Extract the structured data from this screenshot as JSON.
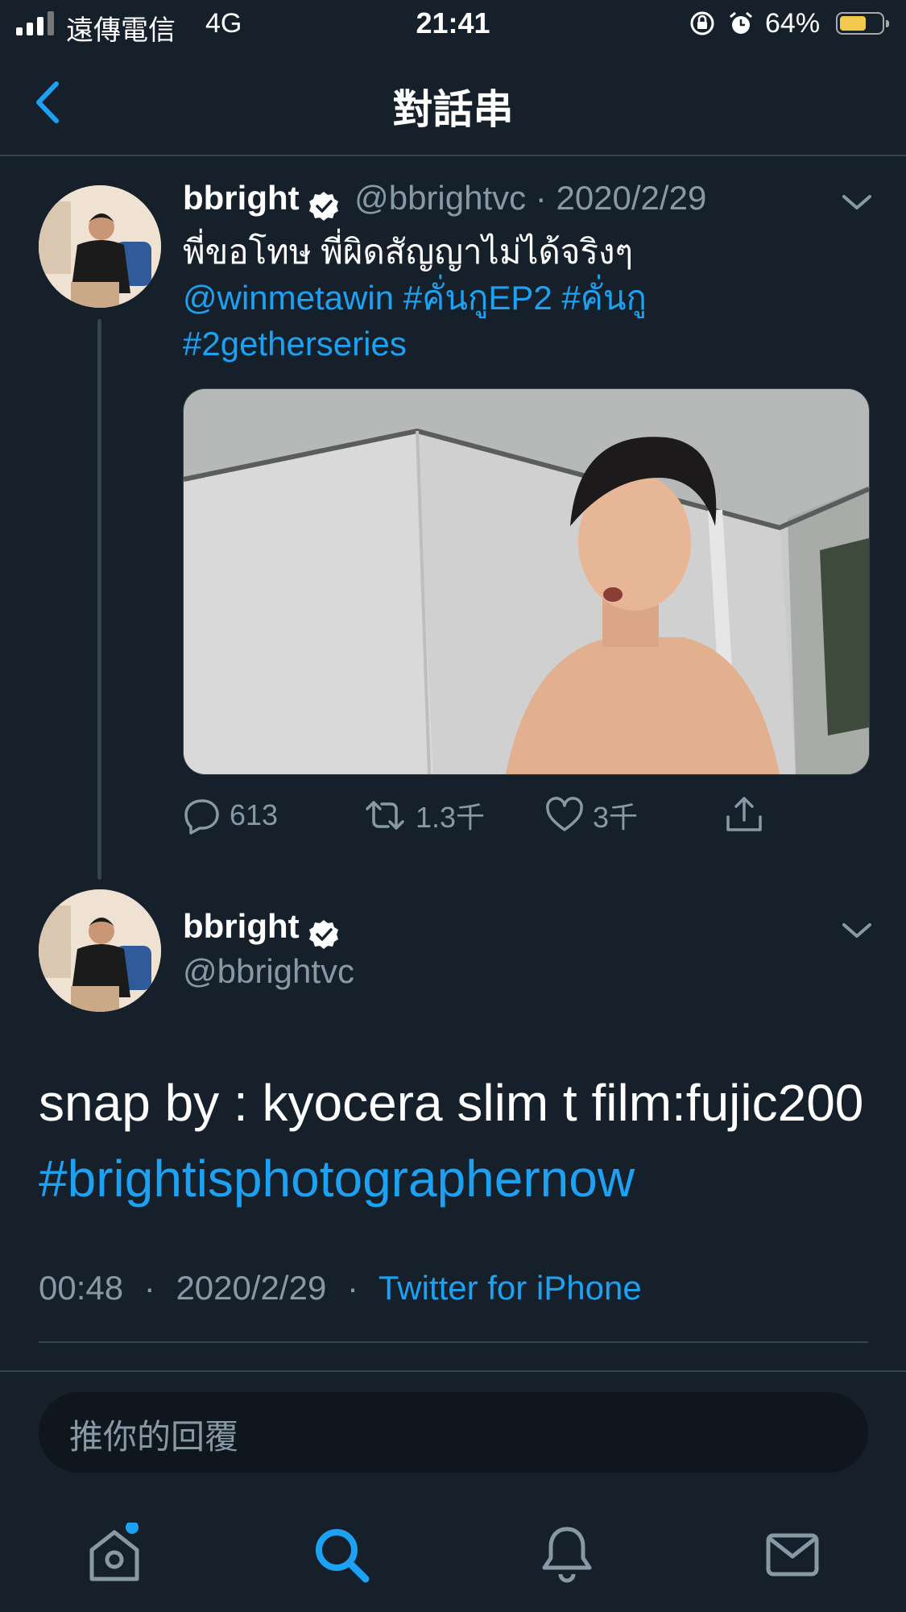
{
  "status_bar": {
    "carrier": "遠傳電信",
    "network": "4G",
    "time": "21:41",
    "battery": "64%",
    "battery_level": 0.64
  },
  "nav": {
    "title": "對話串",
    "back_icon": "chevron-left-icon"
  },
  "tweet1": {
    "name": "bbright",
    "handle_date": "@bbrightvc · 2020/2/29",
    "text_line1": "พี่ขอโทษ พี่ผิดสัญญาไม่ได้จริงๆ",
    "mention": "@winmetawin",
    "hashtag1": "#คั่นกูEP2",
    "hashtag2": "#คั่นกู",
    "hashtag3": "#2getherseries",
    "actions": {
      "replies": "613",
      "retweets": "1.3千",
      "likes": "3千"
    }
  },
  "tweet2": {
    "name": "bbright",
    "handle": "@bbrightvc",
    "text": "snap by : kyocera slim t film:fujic200",
    "hashtag": "#brightisphotographernow",
    "time": "00:48",
    "date": "2020/2/29",
    "source": "Twitter for iPhone"
  },
  "reply": {
    "placeholder": "推你的回覆"
  },
  "tabs": [
    "home-icon",
    "search-icon",
    "notifications-icon",
    "messages-icon"
  ],
  "colors": {
    "background": "#15202b",
    "accent": "#1da1f2",
    "muted": "#8899a6"
  }
}
